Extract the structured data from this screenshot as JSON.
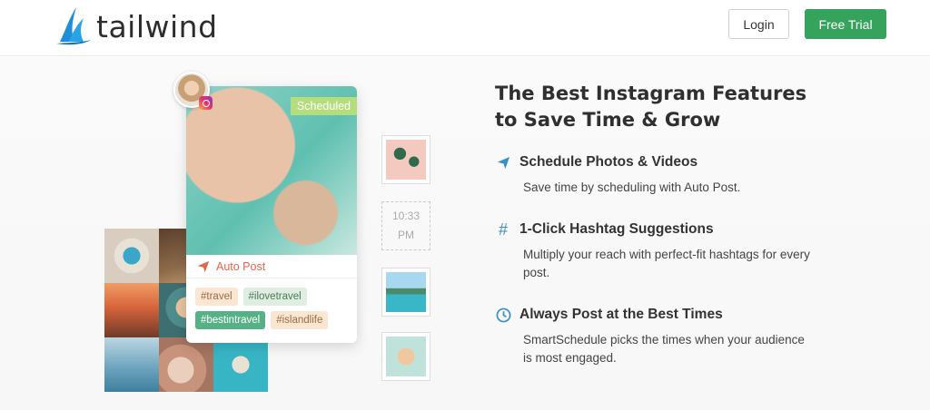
{
  "header": {
    "logo_text": "tailwind",
    "login_label": "Login",
    "trial_label": "Free Trial"
  },
  "card": {
    "scheduled_label": "Scheduled",
    "auto_post_label": "Auto Post",
    "tags": [
      "#travel",
      "#ilovetravel",
      "#bestintravel",
      "#islandlife"
    ]
  },
  "time_slot": {
    "time": "10:33",
    "period": "PM"
  },
  "hero": {
    "headline_line1": "The Best Instagram Features",
    "headline_line2": "to Save Time & Grow"
  },
  "features": [
    {
      "icon": "paper-plane-icon",
      "title": "Schedule Photos & Videos",
      "description": "Save time by scheduling with Auto Post."
    },
    {
      "icon": "hashtag-icon",
      "title": "1-Click Hashtag Suggestions",
      "description": "Multiply your reach with perfect-fit hashtags for every post."
    },
    {
      "icon": "clock-icon",
      "title": "Always Post at the Best Times",
      "description": "SmartSchedule picks the times when your audience is most engaged."
    }
  ],
  "colors": {
    "brand_green": "#35a35b",
    "accent_blue": "#3a8fc8",
    "auto_post_orange": "#e0654c",
    "scheduled_badge": "#b5dd7b"
  }
}
